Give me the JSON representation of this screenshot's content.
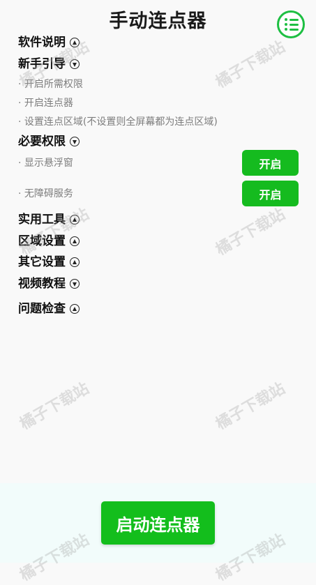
{
  "header": {
    "title": "手动连点器",
    "menu_icon": "list-icon"
  },
  "sections": {
    "software_info": {
      "label": "软件说明",
      "state": "collapsed"
    },
    "beginner_guide": {
      "label": "新手引导",
      "state": "expanded",
      "items": [
        "· 开启所需权限",
        "· 开启连点器",
        "· 设置连点区域(不设置则全屏幕都为连点区域)"
      ]
    },
    "permissions": {
      "label": "必要权限",
      "state": "expanded",
      "items": [
        {
          "label": "· 显示悬浮窗",
          "button": "开启"
        },
        {
          "label": "· 无障碍服务",
          "button": "开启"
        }
      ]
    },
    "tools": {
      "label": "实用工具",
      "state": "collapsed"
    },
    "region": {
      "label": "区域设置",
      "state": "collapsed"
    },
    "other": {
      "label": "其它设置",
      "state": "collapsed"
    },
    "video": {
      "label": "视频教程",
      "state": "expanded"
    },
    "check": {
      "label": "问题检查",
      "state": "collapsed"
    }
  },
  "footer": {
    "start_label": "启动连点器"
  },
  "watermark": {
    "text": "橘子下载站"
  },
  "colors": {
    "accent": "#15bb1f",
    "text": "#111111",
    "subtext": "#7d7d7d"
  }
}
